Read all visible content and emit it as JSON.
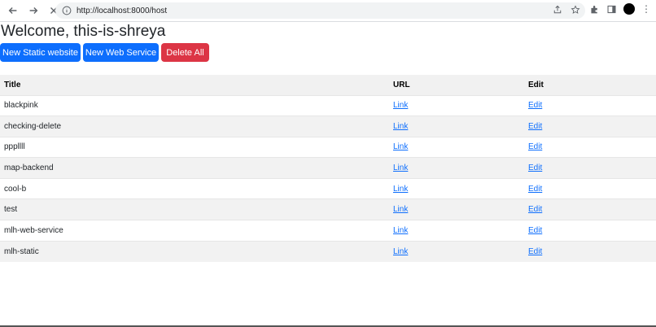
{
  "browser": {
    "url": "http://localhost:8000/host"
  },
  "page": {
    "title": "Welcome, this-is-shreya",
    "buttons": {
      "new_static": "New Static website",
      "new_web_service": "New Web Service",
      "delete_all": "Delete All"
    },
    "table": {
      "headers": [
        "Title",
        "URL",
        "Edit"
      ],
      "rows": [
        {
          "title": "blackpink",
          "url": "Link",
          "edit": "Edit"
        },
        {
          "title": "checking-delete",
          "url": "Link",
          "edit": "Edit"
        },
        {
          "title": "pppllll",
          "url": "Link",
          "edit": "Edit"
        },
        {
          "title": "map-backend",
          "url": "Link",
          "edit": "Edit"
        },
        {
          "title": "cool-b",
          "url": "Link",
          "edit": "Edit"
        },
        {
          "title": "test",
          "url": "Link",
          "edit": "Edit"
        },
        {
          "title": "mlh-web-service",
          "url": "Link",
          "edit": "Edit"
        },
        {
          "title": "mlh-static",
          "url": "Link",
          "edit": "Edit"
        }
      ]
    }
  },
  "colors": {
    "primary": "#0d6efd",
    "danger": "#dc3545"
  }
}
